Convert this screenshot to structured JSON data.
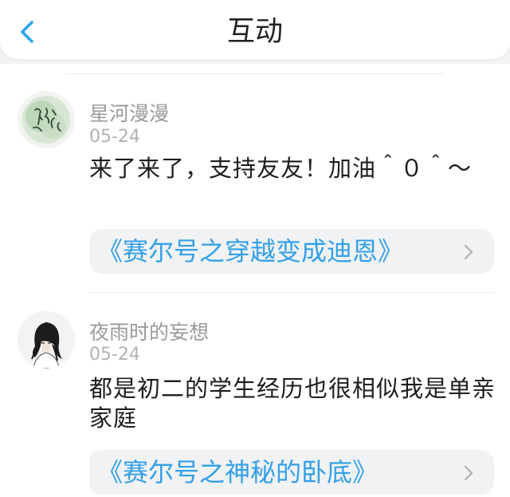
{
  "header": {
    "title": "互动",
    "back_icon": "chevron-left-icon",
    "back_color": "#2aa6e9"
  },
  "comments": [
    {
      "username": "星河漫漫",
      "date": "05-24",
      "content": "来了来了，支持友友！加油＾０＾～",
      "avatar": {
        "style": "calligraphy-seal",
        "text": "星河\n漫漫"
      },
      "book": {
        "title": "《赛尔号之穿越变成迪恩》",
        "chevron": "chevron-right-icon"
      }
    },
    {
      "username": "夜雨时的妄想",
      "date": "05-24",
      "content": "都是初二的学生经历也很相似我是单亲家庭",
      "avatar": {
        "style": "anime-illustration"
      },
      "book": {
        "title": "《赛尔号之神秘的卧底》",
        "chevron": "chevron-right-icon"
      }
    }
  ],
  "colors": {
    "accent": "#2aa6e9",
    "link": "#33a0e8",
    "card_bg": "#f1f2f4",
    "muted_text": "#9a9a9a"
  }
}
